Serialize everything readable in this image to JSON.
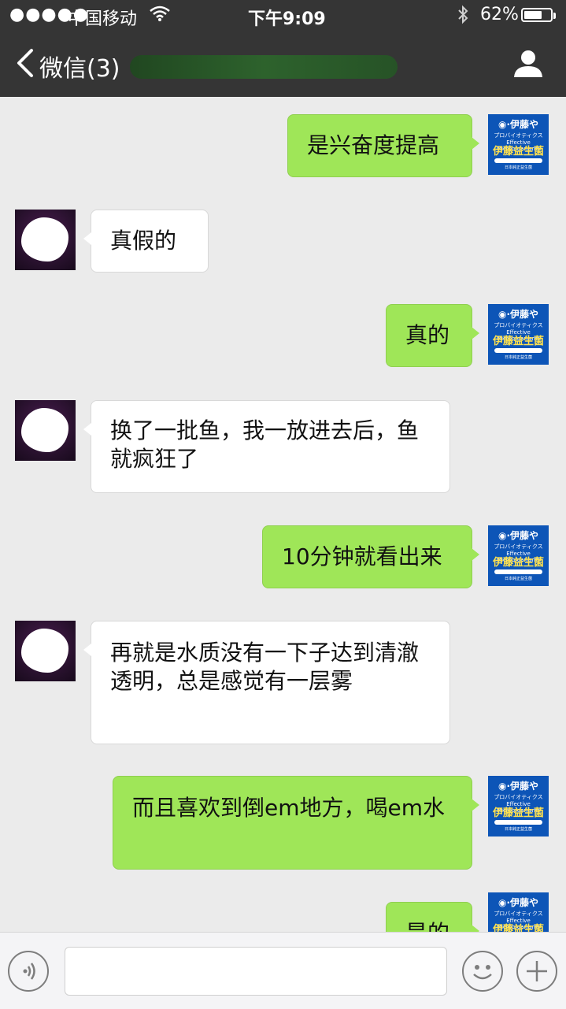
{
  "status": {
    "signal_dots": "●●●●●",
    "carrier": "中国移动",
    "wifi_icon": "wifi-icon",
    "time": "下午9:09",
    "bluetooth_icon": "bluetooth-icon",
    "battery_percent": "62%",
    "battery_level": 0.62
  },
  "navbar": {
    "back_label": "微信(3)",
    "back_icon": "chevron-left-icon",
    "profile_icon": "user-icon"
  },
  "brand_avatar": {
    "line1": "◉·伊藤や",
    "line2": "プロバイオティクス Effective Microorganisms",
    "line3": "伊藤益生菌",
    "line4": "日本純正益生菌",
    "colors": {
      "background": "#0d55b7",
      "title": "#ffe14d"
    }
  },
  "messages": [
    {
      "side": "me",
      "text": "是兴奋度提高"
    },
    {
      "side": "other",
      "text": "真假的"
    },
    {
      "side": "me",
      "text": "真的"
    },
    {
      "side": "other",
      "text": "换了一批鱼，我一放进去后，鱼就疯狂了"
    },
    {
      "side": "me",
      "text": "10分钟就看出来"
    },
    {
      "side": "other",
      "text": "再就是水质没有一下子达到清澈透明，总是感觉有一层雾"
    },
    {
      "side": "me",
      "text": "而且喜欢到倒em地方，喝em水"
    },
    {
      "side": "me",
      "text": "是的"
    }
  ],
  "input_bar": {
    "voice_icon": "voice-icon",
    "emoji_icon": "emoji-icon",
    "plus_icon": "plus-icon",
    "text_value": ""
  },
  "colors": {
    "chat_background": "#ebebeb",
    "my_bubble": "#9fe658",
    "other_bubble": "#ffffff",
    "header": "#353535"
  }
}
